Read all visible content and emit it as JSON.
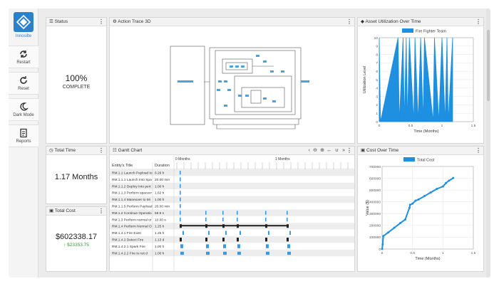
{
  "app": {
    "brand": "Innosilte"
  },
  "sidebar": {
    "buttons": [
      {
        "label": "Restart",
        "icon": "restart-icon"
      },
      {
        "label": "Reset",
        "icon": "reset-icon"
      },
      {
        "label": "Dark Mode",
        "icon": "moon-icon"
      },
      {
        "label": "Reports",
        "icon": "report-icon"
      }
    ]
  },
  "status": {
    "title": "Status",
    "percent": "100%",
    "state": "COMPLETE"
  },
  "trace": {
    "title": "Action Trace 3D"
  },
  "total_time": {
    "title": "Total Time",
    "value": "1.17 Months"
  },
  "total_cost": {
    "title": "Total Cost",
    "value": "$602338.17",
    "delta": "↑ $23353.75"
  },
  "gantt": {
    "title": "Gantt Chart",
    "col_title": "Entity's Title",
    "col_duration": "Duration",
    "months": [
      "0 Months",
      "1 Months"
    ],
    "rows": [
      [
        "RM.1.1 Launch Payload to",
        "6.29 h"
      ],
      [
        "RM.1.1.1 Launch Into Spa",
        "20.00 min"
      ],
      [
        "RM.1.1.2 Deploy Into pert",
        "1.00 h"
      ],
      [
        "RM.1.1.3 Perform spacecr",
        "1.62 h"
      ],
      [
        "RM.1.1.4 Maneuver to Mi",
        "1.00 h"
      ],
      [
        "RM.1.1.5 Perform Payload",
        "20.00 min"
      ],
      [
        "RM.1.2 Continue Operatio",
        "59.9 s"
      ],
      [
        "RM.1.3 Perform normal or",
        "10.00 s"
      ],
      [
        "RM.1.4 Perform Normal O",
        "1.25 h"
      ],
      [
        "RM.1.4.1 Fire Exist",
        "1.25 h"
      ],
      [
        "RM.1.4.2 Detect Fire",
        "1.13 d"
      ],
      [
        "RM.1.4.2.1 Spark Fire",
        "1.00 h"
      ],
      [
        "RM.1.4.2.2 Fire is not d",
        "1.00 h"
      ]
    ]
  },
  "utilization": {
    "title": "Asset Utilization Over Time"
  },
  "cost": {
    "title": "Cost Over Time"
  },
  "chart_data": [
    {
      "type": "area",
      "title": "Asset Utilization Over Time",
      "legend": [
        "Fire Fighter Team"
      ],
      "xlabel": "Time (Months)",
      "ylabel": "Utilization Level",
      "xlim": [
        0,
        1.5
      ],
      "ylim": [
        0,
        10
      ],
      "xticks": [
        "0",
        "0.5",
        "1",
        "1.5"
      ],
      "yticks": [
        "0",
        "1",
        "2",
        "3",
        "4",
        "5",
        "6",
        "7",
        "8",
        "9",
        "10"
      ],
      "color": "#1f8fe0",
      "x": [
        0,
        0.02,
        0.3,
        0.32,
        0.38,
        0.4,
        0.43,
        0.45,
        0.48,
        0.55,
        0.57,
        0.62,
        0.66,
        0.7,
        0.72,
        0.86,
        0.88,
        0.95,
        1.0,
        1.05,
        1.08,
        1.1,
        1.17
      ],
      "values": [
        10,
        0,
        10,
        0,
        10,
        0,
        10,
        0,
        10,
        0,
        10,
        0,
        10,
        0,
        10,
        0,
        10,
        0,
        10,
        0,
        10,
        0,
        10
      ]
    },
    {
      "type": "line",
      "title": "Cost Over Time",
      "legend": [
        "Total Cost"
      ],
      "xlabel": "Time (Months)",
      "ylabel": "Value ($)",
      "xlim": [
        0,
        1.5
      ],
      "ylim": [
        0,
        700000
      ],
      "xticks": [
        "0",
        "0.5",
        "1",
        "1.5"
      ],
      "yticks": [
        "0",
        "100000",
        "200000",
        "300000",
        "400000",
        "500000",
        "600000",
        "700000"
      ],
      "color": "#1f8fe0",
      "x": [
        0,
        0.01,
        0.02,
        0.1,
        0.2,
        0.3,
        0.38,
        0.45,
        0.46,
        0.5,
        0.55,
        0.6,
        0.7,
        0.8,
        0.9,
        1.0,
        1.05,
        1.1,
        1.17
      ],
      "values": [
        0,
        40000,
        110000,
        140000,
        180000,
        220000,
        250000,
        350000,
        375000,
        385000,
        410000,
        420000,
        450000,
        480000,
        510000,
        530000,
        560000,
        580000,
        602338
      ]
    }
  ]
}
